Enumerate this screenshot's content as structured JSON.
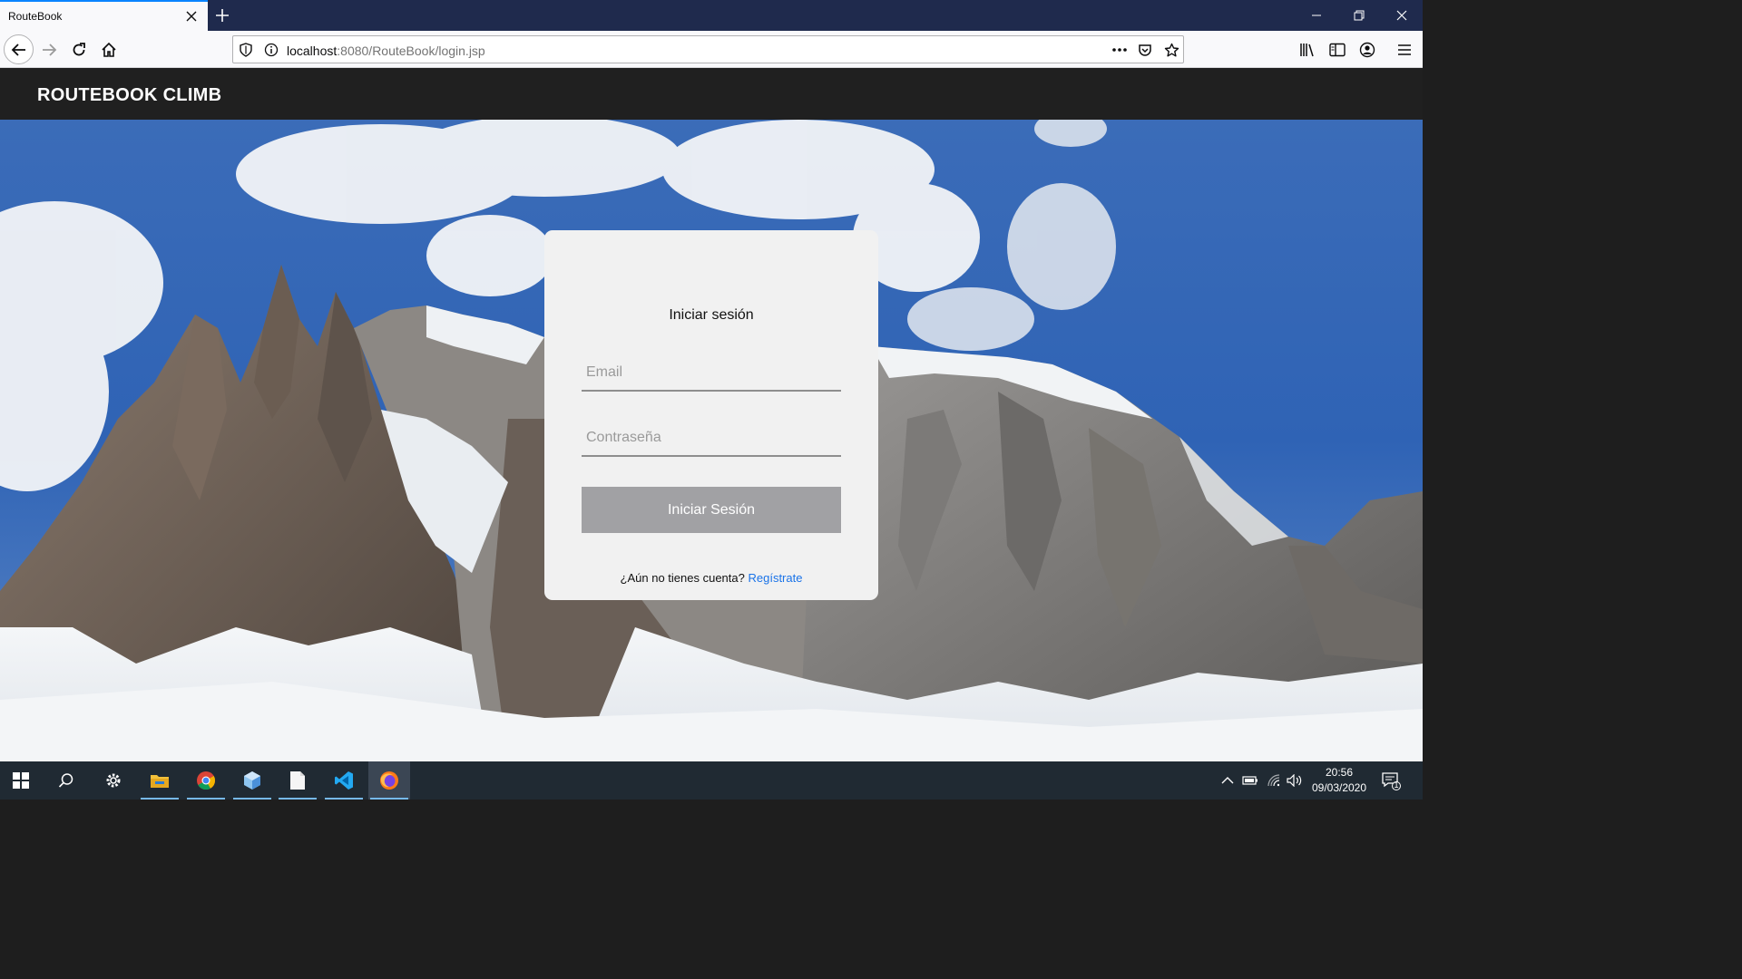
{
  "browser": {
    "tab_title": "RouteBook",
    "url_host": "localhost",
    "url_rest": ":8080/RouteBook/login.jsp"
  },
  "site": {
    "brand_part1": "ROUTEBOOK",
    "brand_part2": "CLIMB"
  },
  "login": {
    "title": "Iniciar sesión",
    "email_placeholder": "Email",
    "password_placeholder": "Contraseña",
    "submit_label": "Iniciar Sesión",
    "register_prompt": "¿Aún no tienes cuenta?",
    "register_link": "Regístrate"
  },
  "taskbar": {
    "time": "20:56",
    "date": "09/03/2020",
    "notifications": "1",
    "apps": [
      "start-icon",
      "search-icon",
      "settings-icon",
      "file-explorer-icon",
      "chrome-icon",
      "3d-viewer-icon",
      "notepad-icon",
      "vscode-icon",
      "firefox-icon"
    ]
  },
  "colors": {
    "accent_tab": "#0a84ff",
    "header_bg": "#202020",
    "button_bg": "#a1a1a4",
    "link": "#1a73e8"
  }
}
